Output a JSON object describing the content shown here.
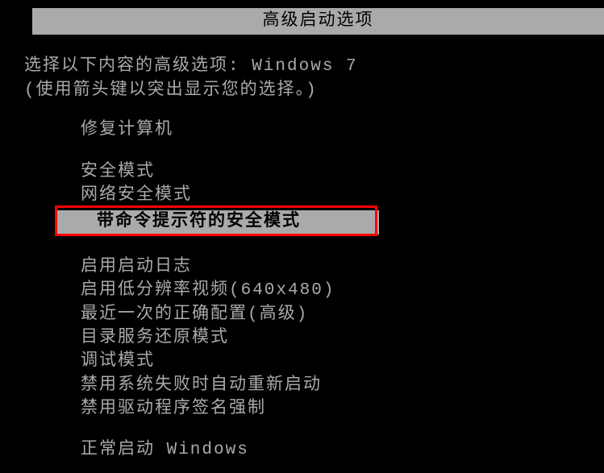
{
  "title": "高级启动选项",
  "prompt_line1": "选择以下内容的高级选项: Windows 7",
  "prompt_line2": "(使用箭头键以突出显示您的选择。)",
  "menu": {
    "items": [
      {
        "label": "修复计算机",
        "selected": false,
        "highlighted": false,
        "group_end": true
      },
      {
        "label": "安全模式",
        "selected": false,
        "highlighted": false,
        "group_end": false
      },
      {
        "label": "网络安全模式",
        "selected": false,
        "highlighted": false,
        "group_end": false
      },
      {
        "label": "带命令提示符的安全模式",
        "selected": true,
        "highlighted": true,
        "group_end": true
      },
      {
        "label": "启用启动日志",
        "selected": false,
        "highlighted": false,
        "group_end": false
      },
      {
        "label": "启用低分辨率视频(640x480)",
        "selected": false,
        "highlighted": false,
        "group_end": false
      },
      {
        "label": "最近一次的正确配置(高级)",
        "selected": false,
        "highlighted": false,
        "group_end": false
      },
      {
        "label": "目录服务还原模式",
        "selected": false,
        "highlighted": false,
        "group_end": false
      },
      {
        "label": "调试模式",
        "selected": false,
        "highlighted": false,
        "group_end": false
      },
      {
        "label": "禁用系统失败时自动重新启动",
        "selected": false,
        "highlighted": false,
        "group_end": false
      },
      {
        "label": "禁用驱动程序签名强制",
        "selected": false,
        "highlighted": false,
        "group_end": true
      },
      {
        "label": "正常启动 Windows",
        "selected": false,
        "highlighted": false,
        "group_end": false
      }
    ]
  }
}
